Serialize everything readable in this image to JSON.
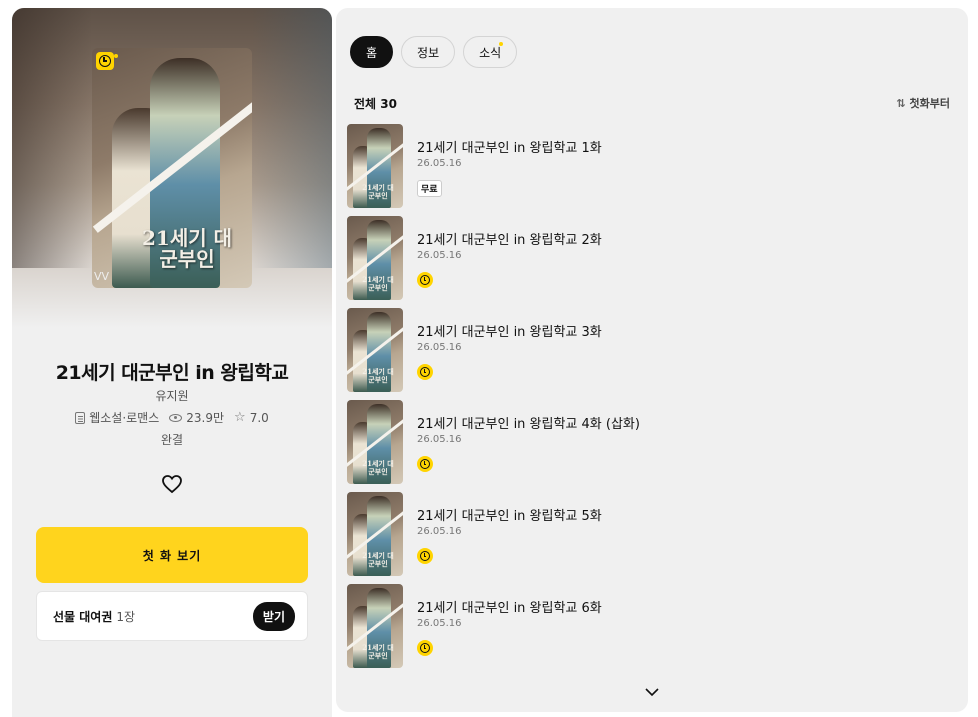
{
  "book": {
    "cover_title": "21세기 대군부인",
    "title": "21세기 대군부인 in 왕립학교",
    "author": "유지원",
    "category": "웹소설·로맨스",
    "views": "23.9만",
    "rating": "7.0",
    "status": "완결",
    "cover_logo": "VV"
  },
  "actions": {
    "start_label": "첫 화 보기",
    "gift_label": "선물 대여권",
    "gift_count": "1장",
    "receive_label": "받기"
  },
  "tabs": [
    {
      "label": "홈",
      "active": true
    },
    {
      "label": "정보",
      "active": false
    },
    {
      "label": "소식",
      "active": false,
      "new": true
    }
  ],
  "episodes_header": {
    "count_label": "전체 30",
    "sort_label": "첫화부터"
  },
  "episodes": [
    {
      "title": "21세기 대군부인 in 왕립학교 1화",
      "date": "26.05.16",
      "badge": "무료"
    },
    {
      "title": "21세기 대군부인 in 왕립학교 2화",
      "date": "26.05.16",
      "badge": "wait-icon"
    },
    {
      "title": "21세기 대군부인 in 왕립학교 3화",
      "date": "26.05.16",
      "badge": "wait-icon"
    },
    {
      "title": "21세기 대군부인 in 왕립학교 4화 (삽화)",
      "date": "26.05.16",
      "badge": "wait-icon"
    },
    {
      "title": "21세기 대군부인 in 왕립학교 5화",
      "date": "26.05.16",
      "badge": "wait-icon"
    },
    {
      "title": "21세기 대군부인 in 왕립학교 6화",
      "date": "26.05.16",
      "badge": "wait-icon"
    }
  ],
  "colors": {
    "accent_yellow": "#ffd41d",
    "panel_bg": "#f0f0f0",
    "active_tab": "#111111"
  }
}
